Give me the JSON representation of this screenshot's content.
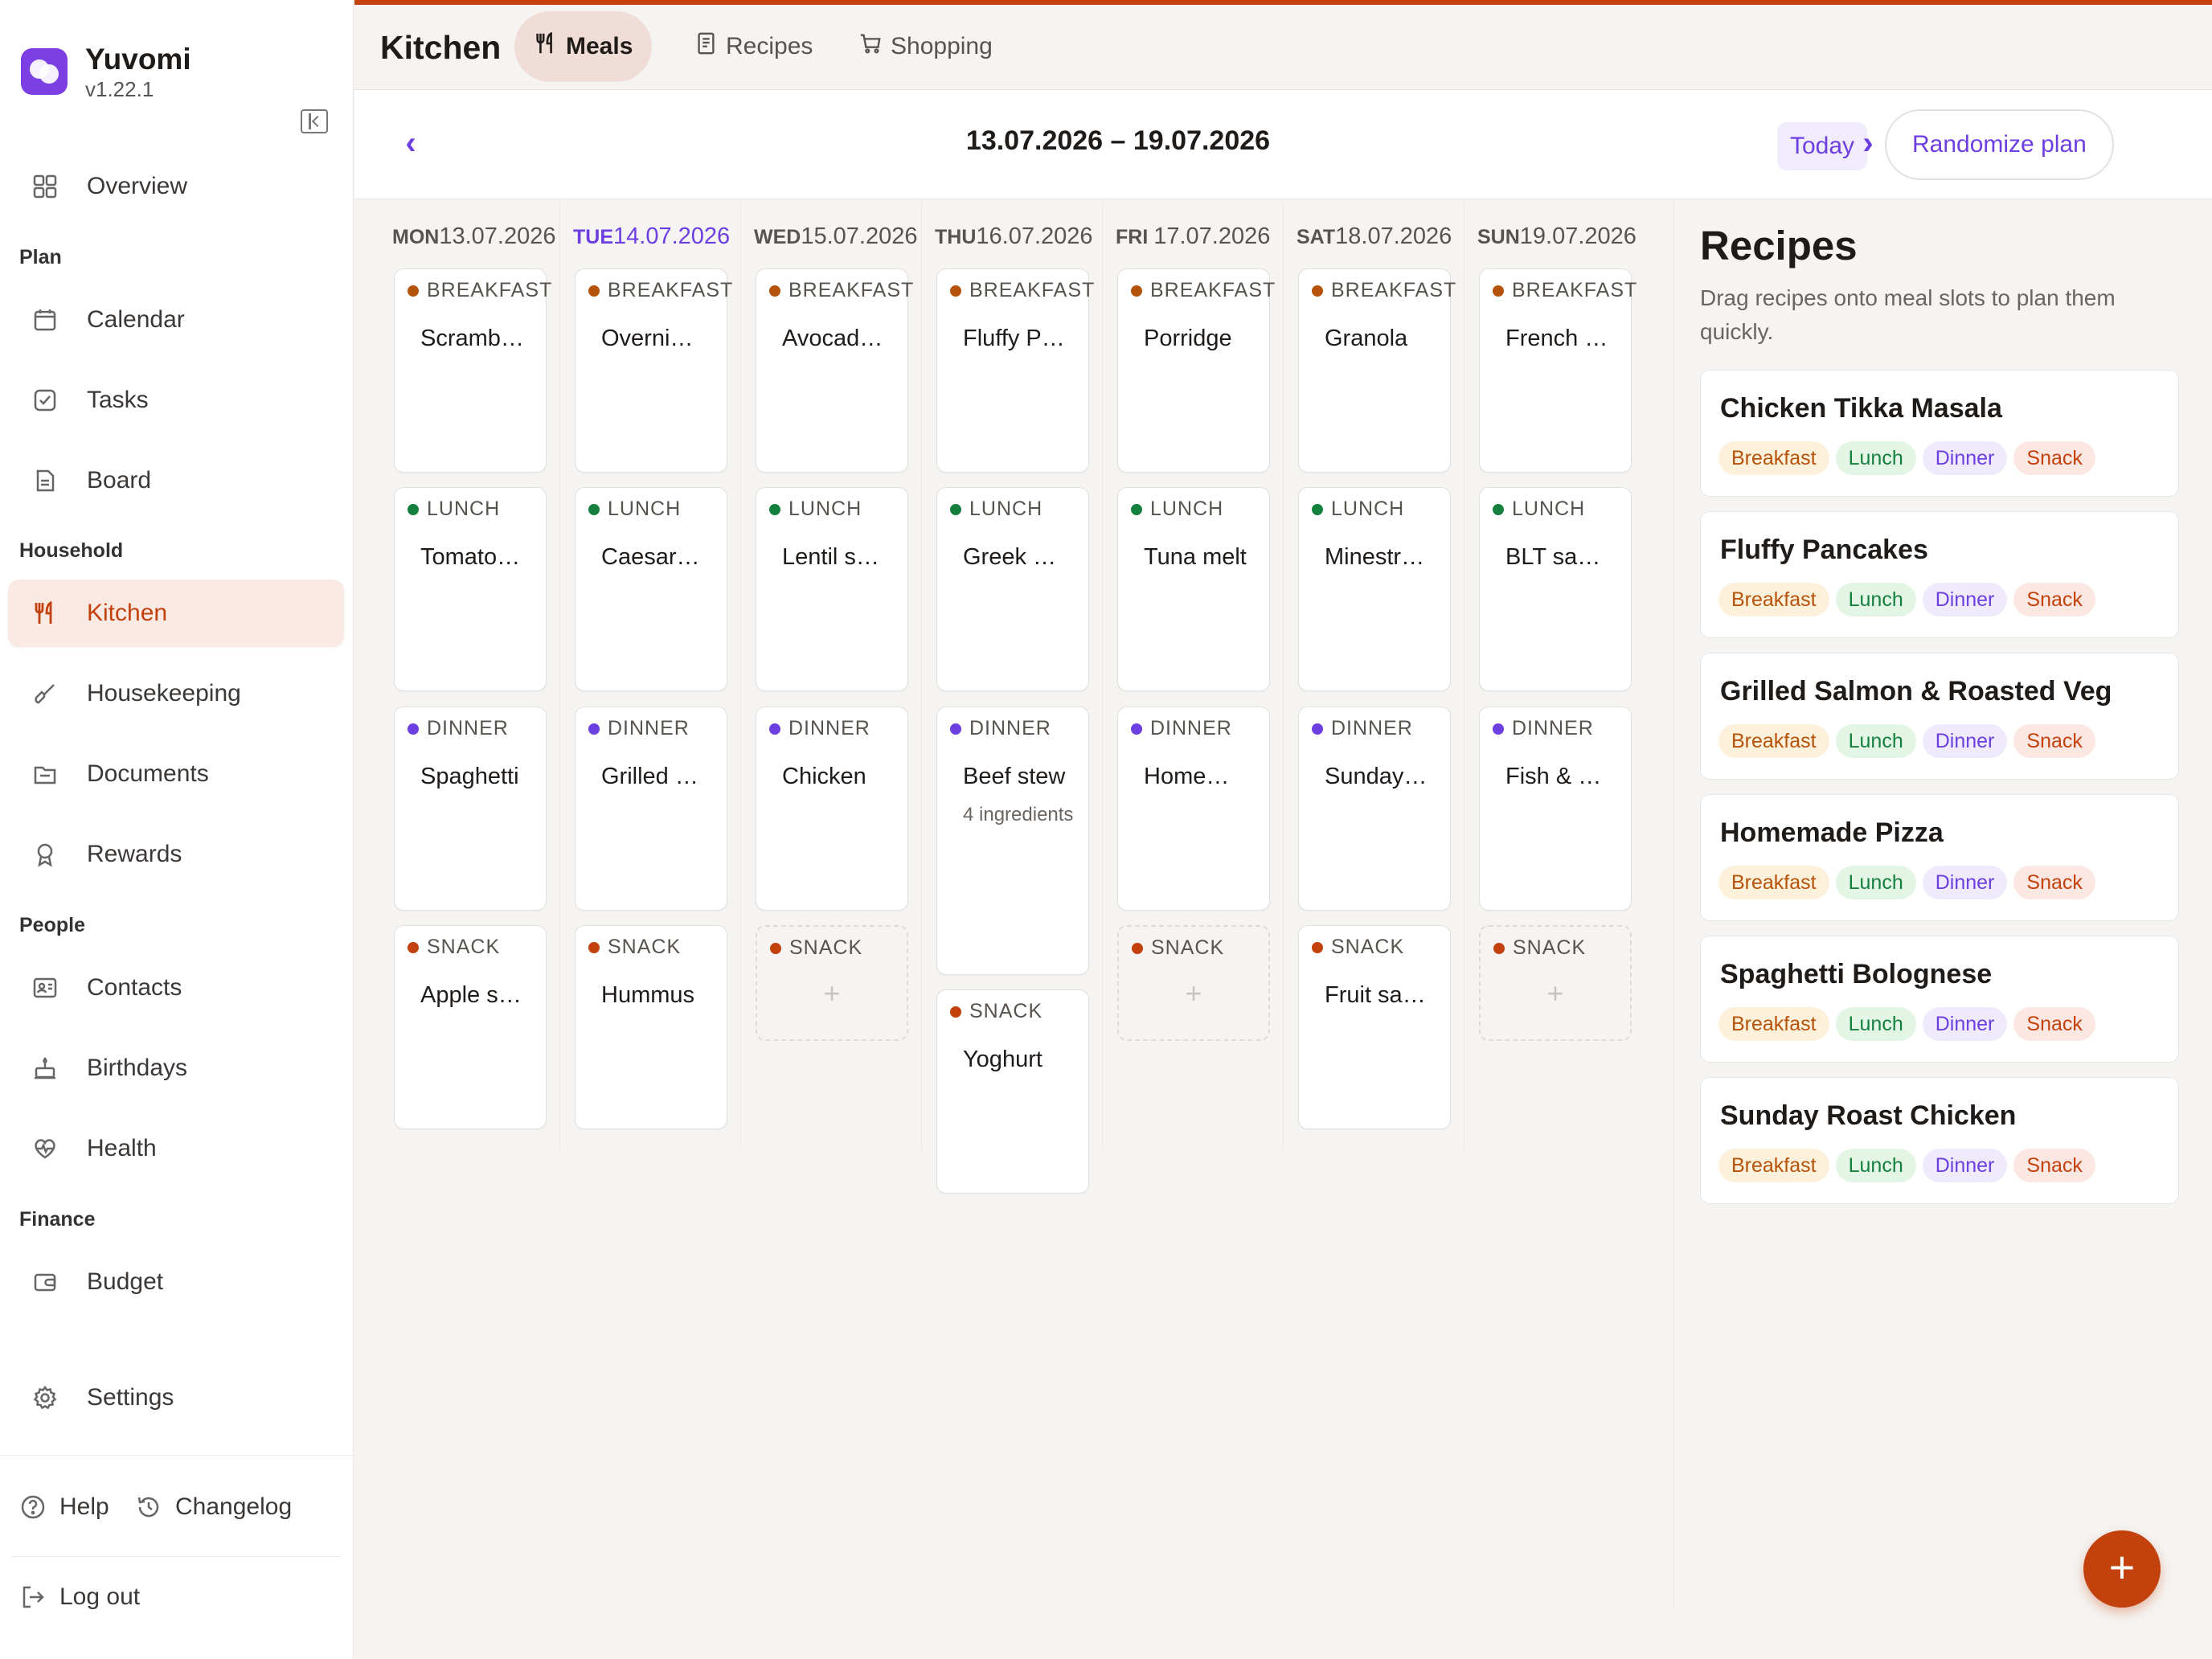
{
  "app": {
    "name": "Yuvomi",
    "version": "v1.22.1"
  },
  "sidebar": {
    "overview": "Overview",
    "sections": {
      "plan": "Plan",
      "household": "Household",
      "people": "People",
      "finance": "Finance"
    },
    "items": {
      "calendar": "Calendar",
      "tasks": "Tasks",
      "board": "Board",
      "kitchen": "Kitchen",
      "housekeeping": "Housekeeping",
      "documents": "Documents",
      "rewards": "Rewards",
      "contacts": "Contacts",
      "birthdays": "Birthdays",
      "health": "Health",
      "budget": "Budget",
      "settings": "Settings"
    },
    "footer": {
      "help": "Help",
      "changelog": "Changelog",
      "logout": "Log out"
    }
  },
  "header": {
    "title": "Kitchen",
    "tabs": {
      "meals": "Meals",
      "recipes": "Recipes",
      "shopping": "Shopping"
    }
  },
  "week": {
    "range": "13.07.2026 – 19.07.2026",
    "today": "Today",
    "randomize": "Randomize plan"
  },
  "days": [
    {
      "dn": "MON",
      "date": "13.07.2026",
      "breakfast": "Scrambled",
      "lunch": "Tomato soup",
      "dinner": "Spaghetti",
      "snack": "Apple slices"
    },
    {
      "dn": "TUE",
      "date": "14.07.2026",
      "breakfast": "Overnight oats",
      "lunch": "Caesar salad",
      "dinner": "Grilled salmon",
      "snack": "Hummus"
    },
    {
      "dn": "WED",
      "date": "15.07.2026",
      "breakfast": "Avocado toast",
      "lunch": "Lentil soup",
      "dinner": "Chicken",
      "snack": ""
    },
    {
      "dn": "THU",
      "date": "16.07.2026",
      "breakfast": "Fluffy Pancakes",
      "lunch": "Greek salad",
      "dinner": "Beef stew",
      "dinner_sub": "4 ingredients",
      "snack": "Yoghurt"
    },
    {
      "dn": "FRI ",
      "date": "17.07.2026",
      "breakfast": "Porridge",
      "lunch": "Tuna melt",
      "dinner": "Homemade Pizza",
      "snack": ""
    },
    {
      "dn": "SAT",
      "date": "18.07.2026",
      "breakfast": "Granola",
      "lunch": "Minestrone",
      "dinner": "Sunday Roast",
      "snack": "Fruit salad"
    },
    {
      "dn": "SUN",
      "date": "19.07.2026",
      "breakfast": "French toast",
      "lunch": "BLT sandwich",
      "dinner": "Fish & chips",
      "snack": ""
    }
  ],
  "meal_types": {
    "breakfast": "BREAKFAST",
    "lunch": "LUNCH",
    "dinner": "DINNER",
    "snack": "SNACK"
  },
  "empty_slot_symbol": "+",
  "recipes_panel": {
    "title": "Recipes",
    "hint": "Drag recipes onto meal slots to plan them quickly.",
    "chips": {
      "breakfast": "Breakfast",
      "lunch": "Lunch",
      "dinner": "Dinner",
      "snack": "Snack"
    },
    "items": [
      "Chicken Tikka Masala",
      "Fluffy Pancakes",
      "Grilled Salmon & Roasted Veg",
      "Homemade Pizza",
      "Spaghetti Bolognese",
      "Sunday Roast Chicken"
    ]
  },
  "colors": {
    "accent": "#c2410c",
    "primary": "#6d3ee0",
    "breakfast_dot": "#b45309",
    "lunch_dot": "#15803d",
    "dinner_dot": "#6d3ee0",
    "snack_dot": "#c2410c"
  }
}
